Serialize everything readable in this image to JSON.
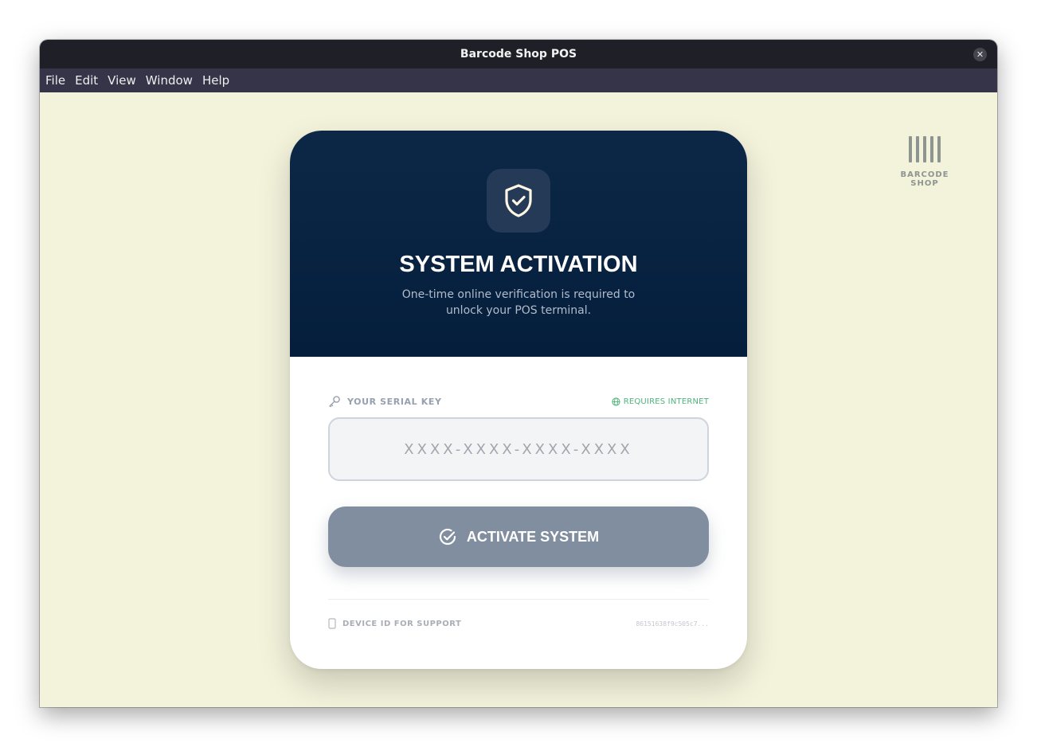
{
  "window": {
    "title": "Barcode Shop POS",
    "close_glyph": "✕"
  },
  "menubar": {
    "items": [
      "File",
      "Edit",
      "View",
      "Window",
      "Help"
    ]
  },
  "brand": {
    "label": "BARCODE SHOP",
    "icon": "barcode-icon"
  },
  "card": {
    "header": {
      "icon": "shield-check-icon",
      "title": "SYSTEM ACTIVATION",
      "subtitle": "One-time online verification is required to unlock your POS terminal."
    },
    "serial": {
      "label": "YOUR SERIAL KEY",
      "label_icon": "key-icon",
      "requirement": "REQUIRES INTERNET",
      "requirement_icon": "globe-icon",
      "placeholder": "XXXX-XXXX-XXXX-XXXX",
      "value": ""
    },
    "activate_button": {
      "label": "ACTIVATE SYSTEM",
      "icon": "check-circle-icon"
    },
    "device": {
      "label": "DEVICE ID FOR SUPPORT",
      "icon": "device-icon",
      "id": "86151638f9c505c7..."
    }
  },
  "colors": {
    "background": "#f3f3dc",
    "header_dark": "#041e3c",
    "button": "#818e9f",
    "success_green": "#4fb47b"
  }
}
